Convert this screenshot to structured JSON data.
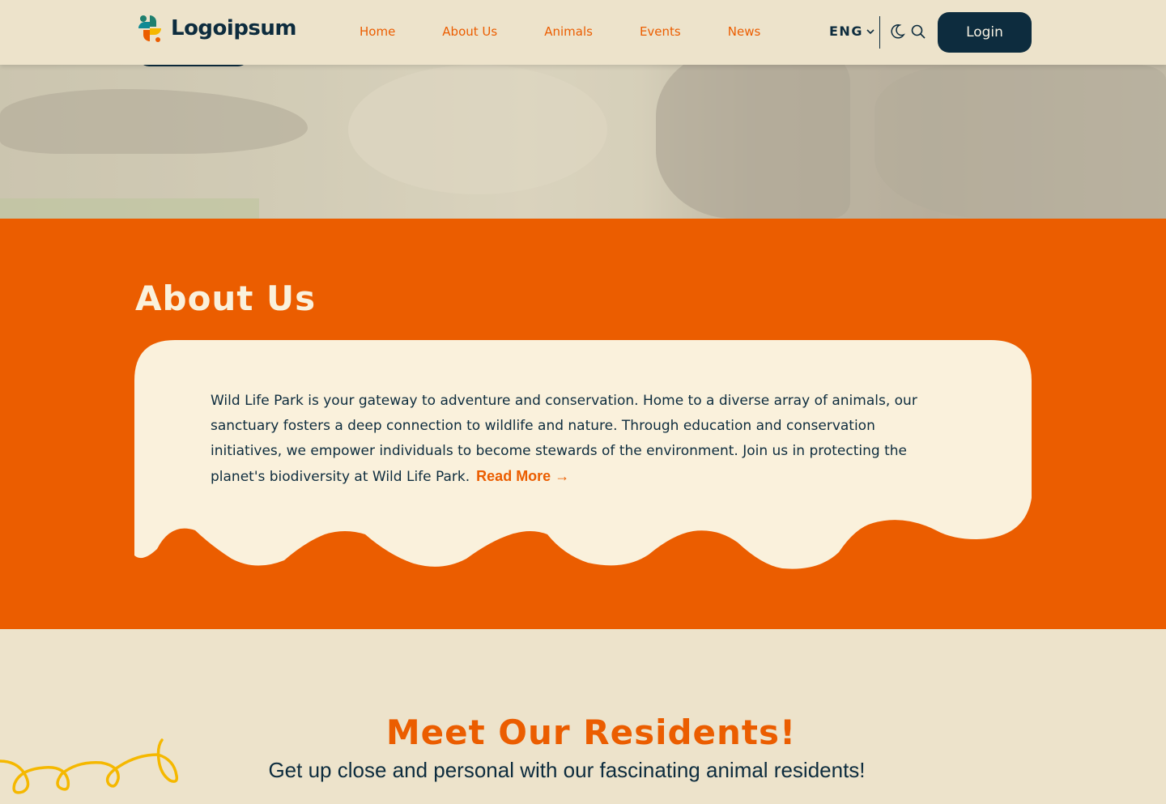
{
  "header": {
    "logo_text": "Logoipsum",
    "nav": [
      "Home",
      "About Us",
      "Animals",
      "Events",
      "News"
    ],
    "language": "ENG",
    "login_label": "Login"
  },
  "about": {
    "title": "About Us",
    "body": "Wild Life Park is your gateway to adventure and conservation. Home to a diverse array of animals, our sanctuary fosters a deep connection to wildlife and nature. Through education and conservation initiatives, we empower individuals to become stewards of the environment. Join us in protecting the planet's biodiversity at Wild Life Park.",
    "read_more": "Read More →"
  },
  "residents": {
    "title": "Meet Our Residents!",
    "subtitle": "Get up close and personal with our fascinating animal residents!"
  },
  "colors": {
    "primary_orange": "#eb5d00",
    "navy": "#0d2c3e",
    "cream": "#faf1dc",
    "background": "#ede3cb",
    "accent_yellow": "#f5b800"
  }
}
